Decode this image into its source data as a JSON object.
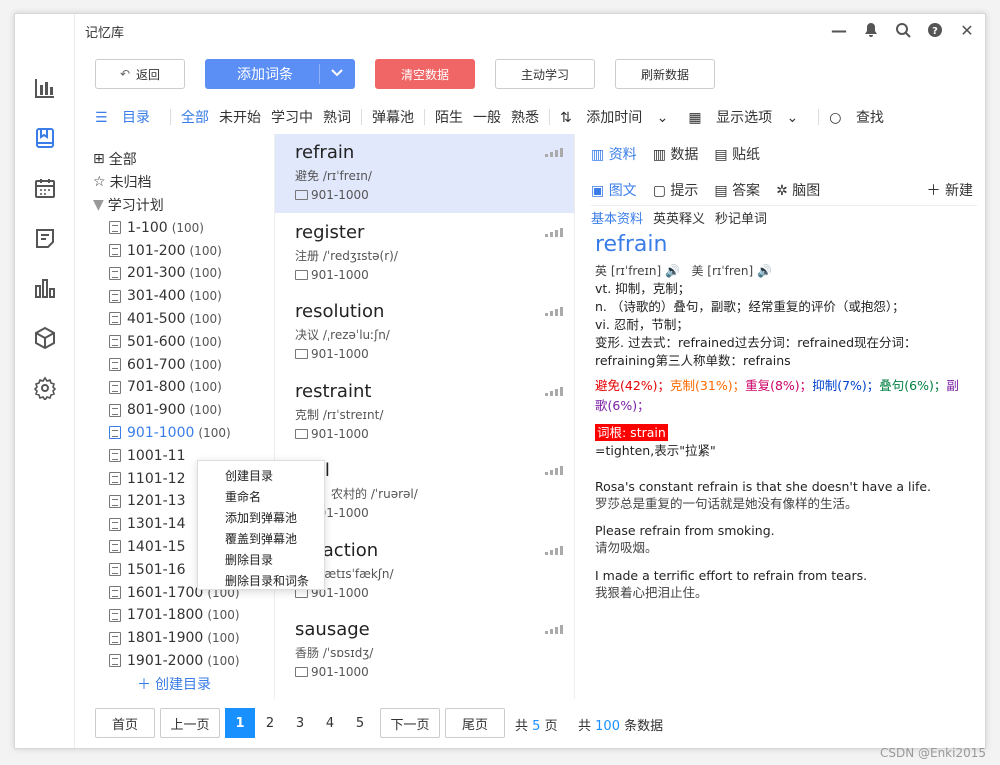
{
  "window": {
    "title": "记忆库"
  },
  "rail_icons": [
    "chart-bars-icon",
    "book-icon",
    "calendar-icon",
    "notes-icon",
    "stats-icon",
    "cube-icon",
    "settings-icon"
  ],
  "toolbar": {
    "back": "返回",
    "add_entry": "添加词条",
    "clear": "清空数据",
    "study": "主动学习",
    "refresh": "刷新数据"
  },
  "filters": {
    "catalog": "目录",
    "all": "全部",
    "not_started": "未开始",
    "learning": "学习中",
    "mastered": "熟词",
    "danmaku_pool": "弹幕池",
    "unfamiliar": "陌生",
    "normal": "一般",
    "familiar": "熟悉",
    "add_time": "添加时间",
    "display_options": "显示选项",
    "search": "查找"
  },
  "tree": {
    "all": "全部",
    "unfiled": "未归档",
    "study_plan": "学习计划",
    "items": [
      {
        "label": "1-100",
        "count": "(100)"
      },
      {
        "label": "101-200",
        "count": "(100)"
      },
      {
        "label": "201-300",
        "count": "(100)"
      },
      {
        "label": "301-400",
        "count": "(100)"
      },
      {
        "label": "401-500",
        "count": "(100)"
      },
      {
        "label": "501-600",
        "count": "(100)"
      },
      {
        "label": "601-700",
        "count": "(100)"
      },
      {
        "label": "701-800",
        "count": "(100)"
      },
      {
        "label": "801-900",
        "count": "(100)"
      },
      {
        "label": "901-1000",
        "count": "(100)"
      },
      {
        "label": "1001-11",
        "count": ""
      },
      {
        "label": "1101-12",
        "count": ""
      },
      {
        "label": "1201-13",
        "count": ""
      },
      {
        "label": "1301-14",
        "count": ""
      },
      {
        "label": "1401-15",
        "count": ""
      },
      {
        "label": "1501-16",
        "count": ""
      },
      {
        "label": "1601-1700",
        "count": "(100)"
      },
      {
        "label": "1701-1800",
        "count": "(100)"
      },
      {
        "label": "1801-1900",
        "count": "(100)"
      },
      {
        "label": "1901-2000",
        "count": "(100)"
      }
    ],
    "create": "创建目录"
  },
  "context_menu": [
    "创建目录",
    "重命名",
    "添加到弹幕池",
    "覆盖到弹幕池",
    "删除目录",
    "删除目录和词条"
  ],
  "words": [
    {
      "word": "refrain",
      "meaning": "避免  /rɪˈfreɪn/",
      "group": "901-1000"
    },
    {
      "word": "register",
      "meaning": "注册  /ˈredʒɪstə(r)/",
      "group": "901-1000"
    },
    {
      "word": "resolution",
      "meaning": "决议  /ˌrezəˈluːʃn/",
      "group": "901-1000"
    },
    {
      "word": "restraint",
      "meaning": "克制  /rɪˈstreɪnt/",
      "group": "901-1000"
    },
    {
      "word": "ural",
      "meaning": "下的，农村的  /ˈruərəl/",
      "group": "901-1000"
    },
    {
      "word": "tisfaction",
      "meaning": "意  /ˌsætɪsˈfækʃn/",
      "group": "901-1000"
    },
    {
      "word": "sausage",
      "meaning": "香肠  /ˈsɒsɪdʒ/",
      "group": "901-1000"
    }
  ],
  "detail": {
    "tabs_top": [
      "资料",
      "数据",
      "贴纸"
    ],
    "tabs_mid": [
      "图文",
      "提示",
      "答案",
      "脑图"
    ],
    "new": "新建",
    "tabs_sub": [
      "基本资料",
      "英英释义",
      "秒记单词"
    ],
    "headword": "refrain",
    "phonetic_uk": "英 [rɪˈfreɪn]",
    "phonetic_us": "美 [rɪˈfren]",
    "defs": [
      "vt. 抑制，克制；",
      "n. （诗歌的）叠句，副歌；经常重复的评价（或抱怨）；",
      "vi. 忍耐，节制；",
      "变形. 过去式：refrained过去分词：refrained现在分词：",
      "refraining第三人称单数：refrains"
    ],
    "freq": [
      {
        "text": "避免(42%)；",
        "color": "#e60000"
      },
      {
        "text": "克制(31%)；",
        "color": "#ff6a00"
      },
      {
        "text": "重复(8%)；",
        "color": "#cc0066"
      },
      {
        "text": "抑制(7%)；",
        "color": "#0044cc"
      },
      {
        "text": "叠句(6%)；",
        "color": "#008040"
      },
      {
        "text": "副歌(6%)；",
        "color": "#7a1fa2"
      }
    ],
    "root_tag": "词根: strain",
    "root_desc": "=tighten,表示\"拉紧\"",
    "examples": [
      {
        "en": "Rosa's constant refrain is that she doesn't have a life.",
        "zh": "罗莎总是重复的一句话就是她没有像样的生活。"
      },
      {
        "en": "Please refrain from smoking.",
        "zh": "请勿吸烟。"
      },
      {
        "en": "I made a terrific effort to refrain from tears.",
        "zh": "我狠着心把泪止住。"
      }
    ]
  },
  "pager": {
    "first": "首页",
    "prev": "上一页",
    "pages": [
      "1",
      "2",
      "3",
      "4",
      "5"
    ],
    "next": "下一页",
    "last": "尾页",
    "total_pages_prefix": "共",
    "total_pages": "5",
    "total_pages_suffix": "页",
    "total_items_prefix": "共",
    "total_items": "100",
    "total_items_suffix": "条数据"
  },
  "watermark": "CSDN @Enki2015"
}
